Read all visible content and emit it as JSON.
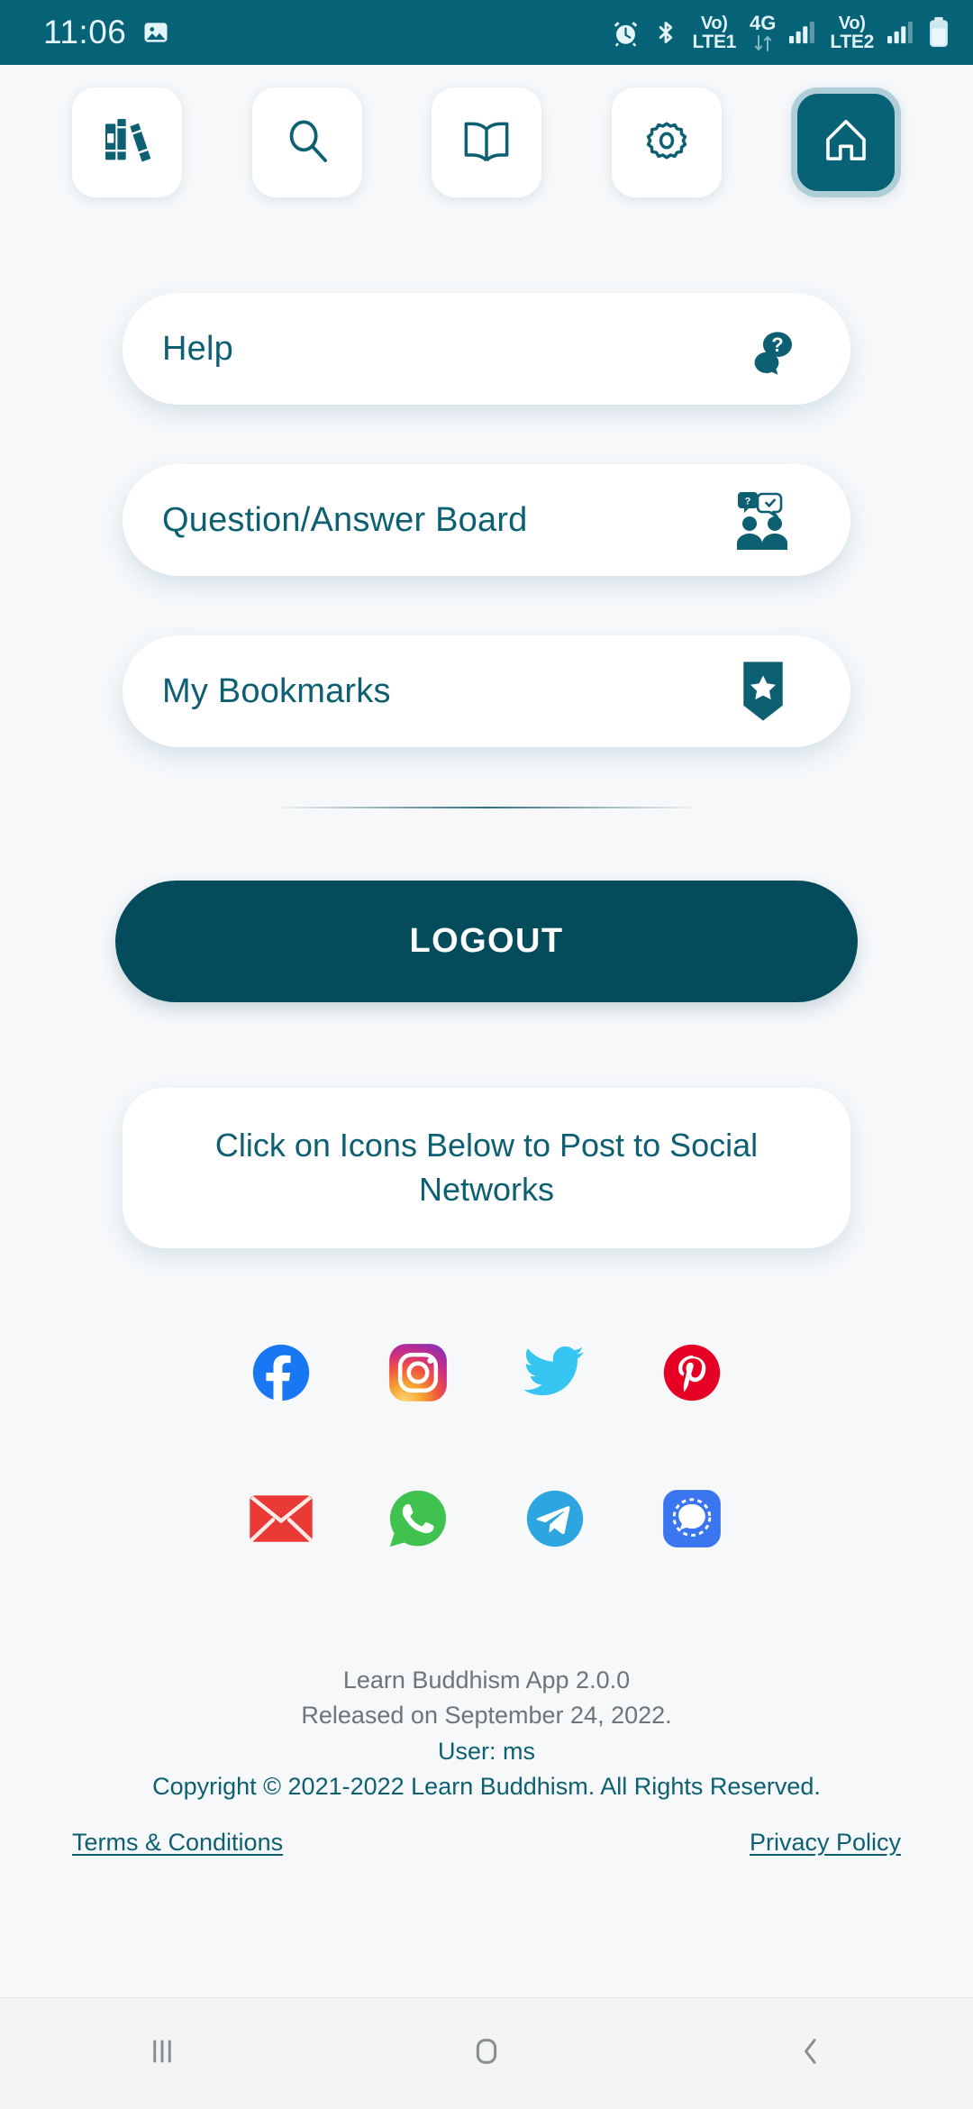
{
  "status_bar": {
    "time": "11:06",
    "left_icons": [
      "gallery-image-icon"
    ],
    "right_icons": [
      "alarm-icon",
      "bluetooth-icon"
    ],
    "sim1": {
      "volte": "Vo)",
      "network": "LTE1"
    },
    "network_type": "4G",
    "sim2": {
      "volte": "Vo)",
      "network": "LTE2"
    },
    "battery": "battery-icon",
    "background_color": "#066276"
  },
  "toolbar": {
    "items": [
      {
        "name": "library-books",
        "icon": "books-icon",
        "active": false
      },
      {
        "name": "search",
        "icon": "search-icon",
        "active": false
      },
      {
        "name": "read",
        "icon": "open-book-icon",
        "active": false
      },
      {
        "name": "settings",
        "icon": "gear-icon",
        "active": false
      },
      {
        "name": "home",
        "icon": "home-icon",
        "active": true
      }
    ]
  },
  "menu": {
    "cards": [
      {
        "label": "Help",
        "icon": "question-speech-bubble-icon"
      },
      {
        "label": "Question/Answer Board",
        "icon": "two-people-qa-icon"
      },
      {
        "label": "My Bookmarks",
        "icon": "bookmark-star-icon"
      }
    ]
  },
  "logout": {
    "label": "LOGOUT",
    "background_color": "#044B5B"
  },
  "social": {
    "prompt": "Click on Icons Below to Post to Social Networks",
    "row1": [
      {
        "name": "facebook",
        "color": "#1877F2"
      },
      {
        "name": "instagram",
        "color": "#E1306C"
      },
      {
        "name": "twitter",
        "color": "#1DA1F2"
      },
      {
        "name": "pinterest",
        "color": "#E60023"
      }
    ],
    "row2": [
      {
        "name": "email",
        "color": "#EA3A35"
      },
      {
        "name": "whatsapp",
        "color": "#3FC34E"
      },
      {
        "name": "telegram",
        "color": "#2CA5E0"
      },
      {
        "name": "signal",
        "color": "#3A76F0"
      }
    ]
  },
  "footer": {
    "app_version": "Learn Buddhism App 2.0.0",
    "release": "Released on September 24, 2022.",
    "user": "User: ms",
    "copyright": "Copyright © 2021-2022 Learn Buddhism. All Rights Reserved.",
    "terms_link": "Terms & Conditions",
    "privacy_link": "Privacy Policy"
  },
  "navbar": {
    "recents": "recents-icon",
    "home": "home-square-icon",
    "back": "back-chevron-icon"
  },
  "theme": {
    "accent": "#0D5F72",
    "status_bar": "#066276",
    "background": "#F6F8FA",
    "card": "#FFFFFF"
  }
}
